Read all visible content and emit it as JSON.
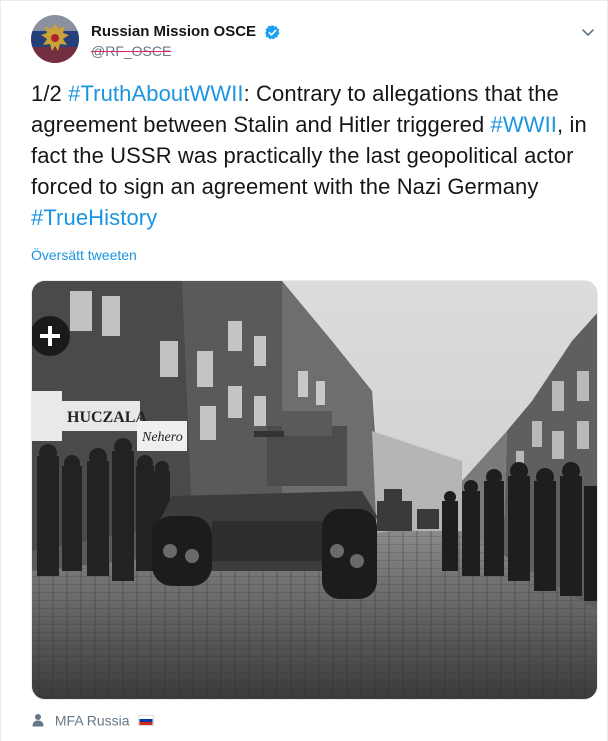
{
  "tweet": {
    "author": {
      "display_name": "Russian Mission OSCE",
      "handle": "@RF_OSCE",
      "verified": true,
      "avatar_icon": "russian-coat-of-arms-avatar"
    },
    "text_segments": [
      {
        "type": "text",
        "value": "1/2 "
      },
      {
        "type": "hashtag",
        "value": "#TruthAboutWWII"
      },
      {
        "type": "text",
        "value": ": Contrary to allegations that the agreement between Stalin and Hitler triggered "
      },
      {
        "type": "hashtag",
        "value": "#WWII"
      },
      {
        "type": "text",
        "value": ", in fact the USSR was practically the last geopolitical actor forced to sign an agreement with the Nazi Germany "
      },
      {
        "type": "hashtag",
        "value": "#TrueHistory"
      }
    ],
    "translate_label": "Översätt tweeten",
    "photo": {
      "signs": [
        "HUCZALA",
        "Nehero"
      ]
    },
    "tagged": {
      "label": "MFA Russia",
      "flag_icon": "russia-flag-icon"
    }
  },
  "colors": {
    "link": "#1b95e0",
    "text": "#14171a",
    "secondary": "#657786",
    "verified": "#1da1f2"
  }
}
